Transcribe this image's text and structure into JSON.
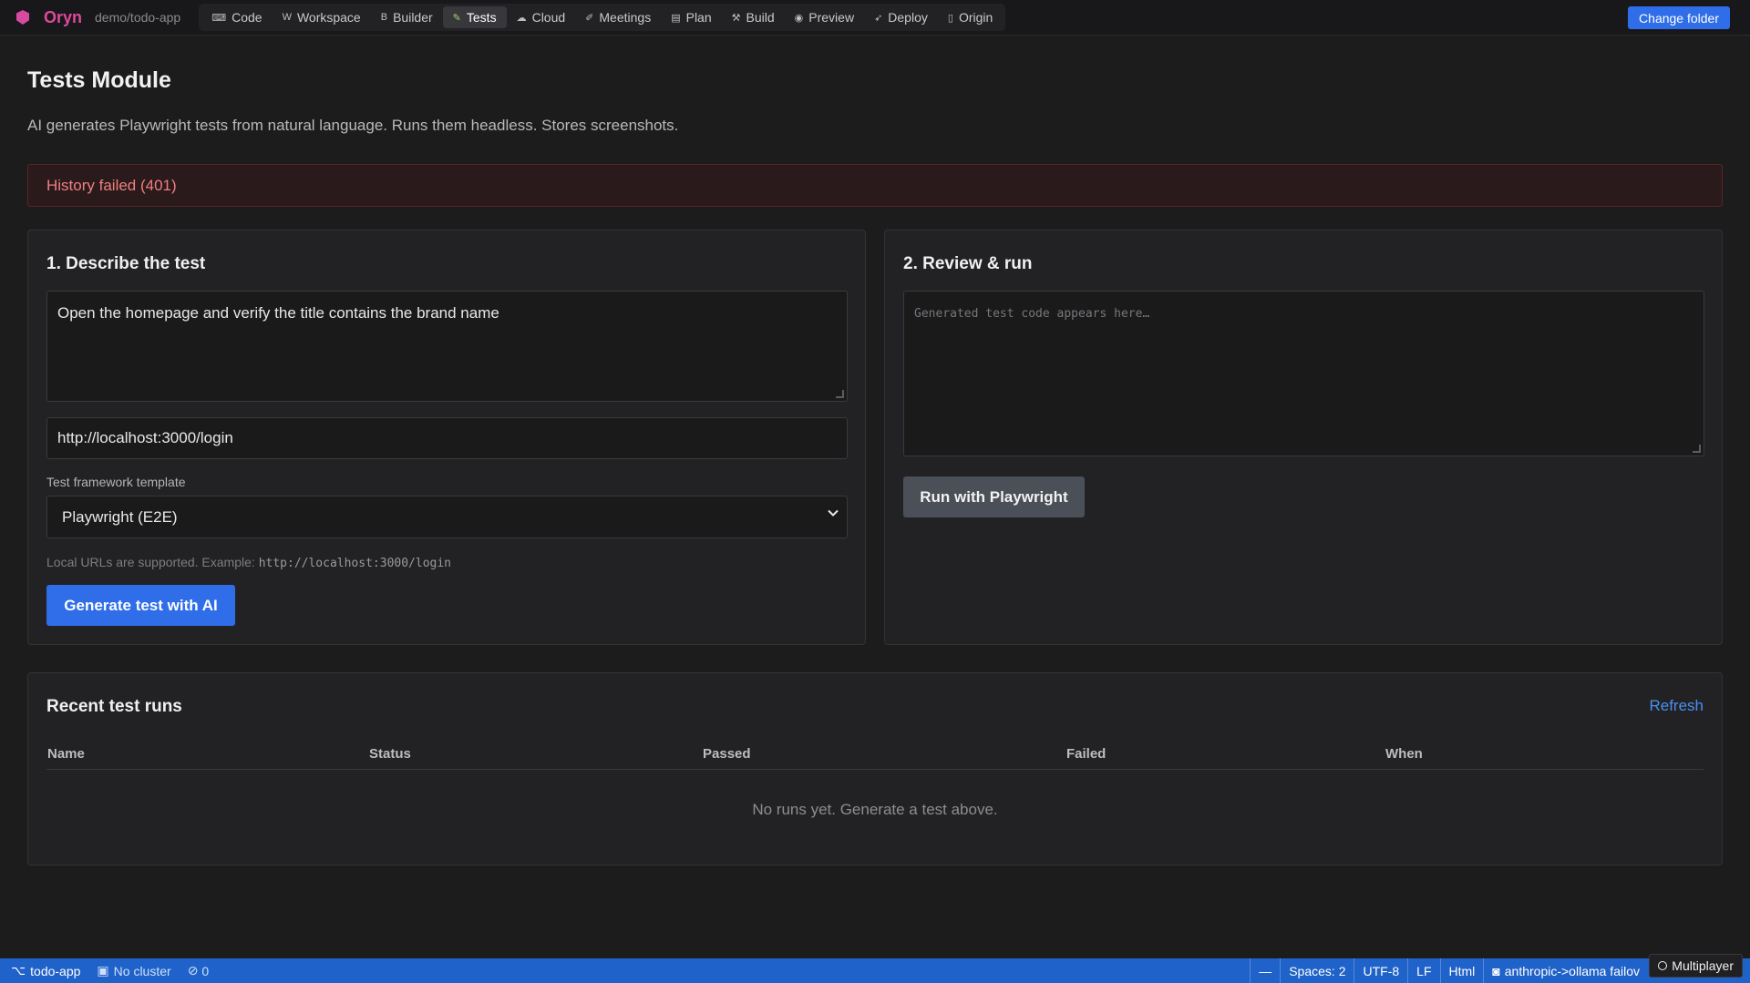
{
  "app": {
    "name": "Oryn",
    "path": "demo/todo-app"
  },
  "nav": {
    "tabs": [
      {
        "label": "Code",
        "icon": "terminal-icon",
        "glyph": "⌨"
      },
      {
        "label": "Workspace",
        "icon": "workspace-icon",
        "glyph": "W"
      },
      {
        "label": "Builder",
        "icon": "builder-icon",
        "glyph": "B"
      },
      {
        "label": "Tests",
        "icon": "pencil-icon",
        "glyph": "✎"
      },
      {
        "label": "Cloud",
        "icon": "cloud-icon",
        "glyph": "☁"
      },
      {
        "label": "Meetings",
        "icon": "meeting-icon",
        "glyph": "✐"
      },
      {
        "label": "Plan",
        "icon": "document-icon",
        "glyph": "▤"
      },
      {
        "label": "Build",
        "icon": "hammer-icon",
        "glyph": "⚒"
      },
      {
        "label": "Preview",
        "icon": "eye-icon",
        "glyph": "◉"
      },
      {
        "label": "Deploy",
        "icon": "rocket-icon",
        "glyph": "➶"
      },
      {
        "label": "Origin",
        "icon": "file-icon",
        "glyph": "▯"
      }
    ],
    "active": "Tests"
  },
  "header": {
    "change_folder_label": "Change folder"
  },
  "page": {
    "title": "Tests Module",
    "subtitle": "AI generates Playwright tests from natural language. Runs them headless. Stores screenshots.",
    "error": "History failed (401)"
  },
  "describe": {
    "title": "1. Describe the test",
    "description_value": "Open the homepage and verify the title contains the brand name",
    "url_value": "http://localhost:3000/login",
    "framework_label": "Test framework template",
    "framework_value": "Playwright (E2E)",
    "hint_text": "Local URLs are supported. Example:",
    "hint_code": "http://localhost:3000/login",
    "generate_label": "Generate test with AI"
  },
  "review": {
    "title": "2. Review & run",
    "code_placeholder": "Generated test code appears here…",
    "run_label": "Run with Playwright"
  },
  "runs": {
    "title": "Recent test runs",
    "refresh_label": "Refresh",
    "columns": [
      "Name",
      "Status",
      "Passed",
      "Failed",
      "When"
    ],
    "empty_message": "No runs yet. Generate a test above."
  },
  "statusbar": {
    "branch": "todo-app",
    "cluster": "No cluster",
    "problems": "0",
    "dash": "—",
    "spaces": "Spaces: 2",
    "encoding": "UTF-8",
    "eol": "LF",
    "language": "Html",
    "ai_provider": "anthropic->ollama failov",
    "multiplayer": "Multiplayer"
  },
  "colors": {
    "accent": "#2f6de9",
    "brand": "#e0489c",
    "error_text": "#f07f7f",
    "statusbar": "#1f62c9"
  }
}
